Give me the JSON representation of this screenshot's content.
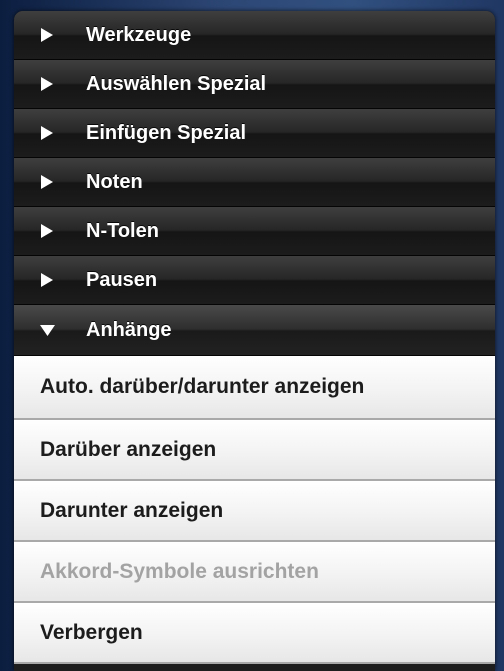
{
  "sections": [
    {
      "label": "Werkzeuge",
      "expanded": false,
      "icon": "triangle-right-icon"
    },
    {
      "label": "Auswählen Spezial",
      "expanded": false,
      "icon": "triangle-right-icon"
    },
    {
      "label": "Einfügen Spezial",
      "expanded": false,
      "icon": "triangle-right-icon"
    },
    {
      "label": "Noten",
      "expanded": false,
      "icon": "triangle-right-icon"
    },
    {
      "label": "N-Tolen",
      "expanded": false,
      "icon": "triangle-right-icon"
    },
    {
      "label": "Pausen",
      "expanded": false,
      "icon": "triangle-right-icon"
    },
    {
      "label": "Anhänge",
      "expanded": true,
      "icon": "triangle-down-icon"
    }
  ],
  "expanded_items": [
    {
      "label": "Auto. darüber/darunter anzeigen",
      "enabled": true
    },
    {
      "label": "Darüber anzeigen",
      "enabled": true
    },
    {
      "label": "Darunter anzeigen",
      "enabled": true
    },
    {
      "label": "Akkord-Symbole ausrichten",
      "enabled": false
    },
    {
      "label": "Verbergen",
      "enabled": true
    }
  ],
  "colors": {
    "header_text": "#ffffff",
    "item_text": "#1c1c1c",
    "item_disabled_text": "#a3a3a3",
    "background": "#2d4775"
  }
}
